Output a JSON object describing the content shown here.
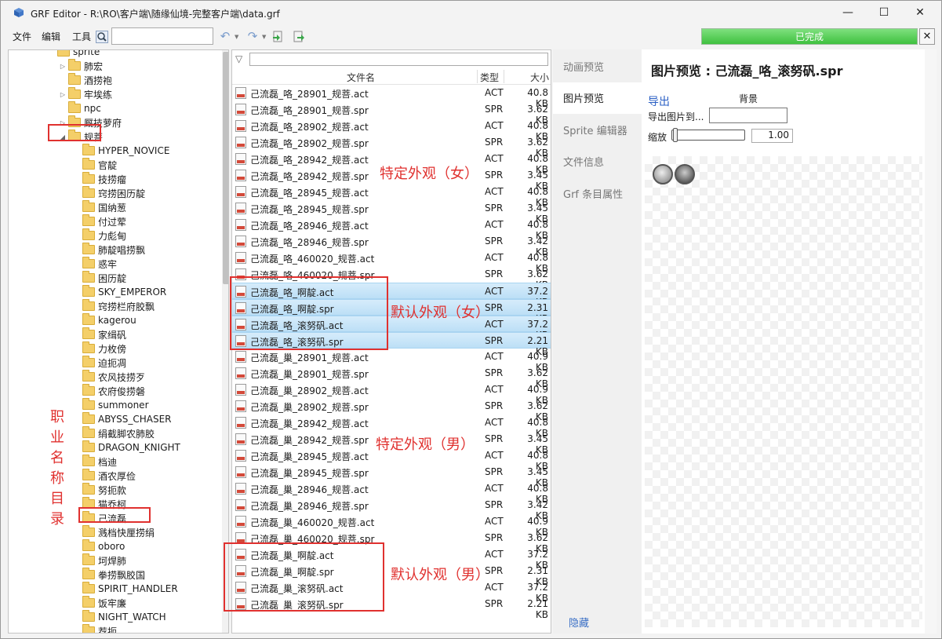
{
  "window": {
    "title": "GRF Editor - R:\\RO\\客户端\\随缘仙境-完整客户端\\data.grf",
    "min_glyph": "—",
    "max_glyph": "☐",
    "close_glyph": "✕"
  },
  "toolbar": {
    "menu_file": "文件",
    "menu_edit": "编辑",
    "menu_tools": "工具",
    "search_value": "",
    "progress_text": "已完成",
    "progress_value": 1.0,
    "progress_close": "✕",
    "icons": [
      "search-icon",
      "undo-icon",
      "redo-icon",
      "extract-icon",
      "export-icon"
    ]
  },
  "tree": {
    "nodes": [
      {
        "label": "sprite",
        "level": 1,
        "arrow": ""
      },
      {
        "label": "肺宏",
        "level": 2,
        "arrow": "▷"
      },
      {
        "label": "酒捞袍",
        "level": 2,
        "arrow": ""
      },
      {
        "label": "牢埃练",
        "level": 2,
        "arrow": "▷"
      },
      {
        "label": "npc",
        "level": 2,
        "arrow": ""
      },
      {
        "label": "厩技萝府",
        "level": 2,
        "arrow": "▷"
      },
      {
        "label": "规菩",
        "level": 2,
        "arrow": "◢"
      },
      {
        "label": "HYPER_NOVICE",
        "level": 3,
        "arrow": ""
      },
      {
        "label": "官靛",
        "level": 3,
        "arrow": ""
      },
      {
        "label": "技捞瘤",
        "level": 3,
        "arrow": ""
      },
      {
        "label": "窍捞困历靛",
        "level": 3,
        "arrow": ""
      },
      {
        "label": "国纳葱",
        "level": 3,
        "arrow": ""
      },
      {
        "label": "付过荤",
        "level": 3,
        "arrow": ""
      },
      {
        "label": "力彪甸",
        "level": 3,
        "arrow": ""
      },
      {
        "label": "肺靛唱捞飘",
        "level": 3,
        "arrow": ""
      },
      {
        "label": "惑牢",
        "level": 3,
        "arrow": ""
      },
      {
        "label": "困历靛",
        "level": 3,
        "arrow": ""
      },
      {
        "label": "SKY_EMPEROR",
        "level": 3,
        "arrow": ""
      },
      {
        "label": "窍捞栏府胶飘",
        "level": 3,
        "arrow": ""
      },
      {
        "label": "kagerou",
        "level": 3,
        "arrow": ""
      },
      {
        "label": "家缉矾",
        "level": 3,
        "arrow": ""
      },
      {
        "label": "力枚傍",
        "level": 3,
        "arrow": ""
      },
      {
        "label": "迫扼凋",
        "level": 3,
        "arrow": ""
      },
      {
        "label": "农风技捞歹",
        "level": 3,
        "arrow": ""
      },
      {
        "label": "农府俊捞磐",
        "level": 3,
        "arrow": ""
      },
      {
        "label": "summoner",
        "level": 3,
        "arrow": ""
      },
      {
        "label": "ABYSS_CHASER",
        "level": 3,
        "arrow": ""
      },
      {
        "label": "绢截脚农肺胶",
        "level": 3,
        "arrow": ""
      },
      {
        "label": "DRAGON_KNIGHT",
        "level": 3,
        "arrow": ""
      },
      {
        "label": "档迪",
        "level": 3,
        "arrow": ""
      },
      {
        "label": "酒农厚俭",
        "level": 3,
        "arrow": ""
      },
      {
        "label": "努扼款",
        "level": 3,
        "arrow": ""
      },
      {
        "label": "猫乔柯",
        "level": 3,
        "arrow": ""
      },
      {
        "label": "己流磊",
        "level": 3,
        "arrow": ""
      },
      {
        "label": "溅档快厘捞绢",
        "level": 3,
        "arrow": ""
      },
      {
        "label": "oboro",
        "level": 3,
        "arrow": ""
      },
      {
        "label": "坷焊肺",
        "level": 3,
        "arrow": ""
      },
      {
        "label": "拳捞飘胶国",
        "level": 3,
        "arrow": ""
      },
      {
        "label": "SPIRIT_HANDLER",
        "level": 3,
        "arrow": ""
      },
      {
        "label": "饭牢廉",
        "level": 3,
        "arrow": ""
      },
      {
        "label": "NIGHT_WATCH",
        "level": 3,
        "arrow": ""
      },
      {
        "label": "荐扼",
        "level": 3,
        "arrow": ""
      }
    ],
    "annot_vertical": [
      "职",
      "业",
      "名",
      "称",
      "目",
      "录"
    ]
  },
  "filelist": {
    "filter_value": "",
    "headers": {
      "name": "文件名",
      "type": "类型",
      "size": "大小"
    },
    "rows": [
      {
        "name": "己流磊_咯_28901_规菩.act",
        "type": "ACT",
        "size": "40.8 KB",
        "sel": false
      },
      {
        "name": "己流磊_咯_28901_规菩.spr",
        "type": "SPR",
        "size": "3.62 KB",
        "sel": false
      },
      {
        "name": "己流磊_咯_28902_规菩.act",
        "type": "ACT",
        "size": "40.8 KB",
        "sel": false
      },
      {
        "name": "己流磊_咯_28902_规菩.spr",
        "type": "SPR",
        "size": "3.62 KB",
        "sel": false
      },
      {
        "name": "己流磊_咯_28942_规菩.act",
        "type": "ACT",
        "size": "40.8 KB",
        "sel": false
      },
      {
        "name": "己流磊_咯_28942_规菩.spr",
        "type": "SPR",
        "size": "3.45 KB",
        "sel": false
      },
      {
        "name": "己流磊_咯_28945_规菩.act",
        "type": "ACT",
        "size": "40.8 KB",
        "sel": false
      },
      {
        "name": "己流磊_咯_28945_规菩.spr",
        "type": "SPR",
        "size": "3.45 KB",
        "sel": false
      },
      {
        "name": "己流磊_咯_28946_规菩.act",
        "type": "ACT",
        "size": "40.8 KB",
        "sel": false
      },
      {
        "name": "己流磊_咯_28946_规菩.spr",
        "type": "SPR",
        "size": "3.42 KB",
        "sel": false
      },
      {
        "name": "己流磊_咯_460020_规菩.act",
        "type": "ACT",
        "size": "40.8 KB",
        "sel": false
      },
      {
        "name": "己流磊_咯_460020_规菩.spr",
        "type": "SPR",
        "size": "3.62 KB",
        "sel": false
      },
      {
        "name": "己流磊_咯_啊靛.act",
        "type": "ACT",
        "size": "37.2 KB",
        "sel": true
      },
      {
        "name": "己流磊_咯_啊靛.spr",
        "type": "SPR",
        "size": "2.31 KB",
        "sel": true
      },
      {
        "name": "己流磊_咯_滚努矾.act",
        "type": "ACT",
        "size": "37.2 KB",
        "sel": true
      },
      {
        "name": "己流磊_咯_滚努矾.spr",
        "type": "SPR",
        "size": "2.21 KB",
        "sel": true
      },
      {
        "name": "己流磊_巢_28901_规菩.act",
        "type": "ACT",
        "size": "40.9 KB",
        "sel": false
      },
      {
        "name": "己流磊_巢_28901_规菩.spr",
        "type": "SPR",
        "size": "3.62 KB",
        "sel": false
      },
      {
        "name": "己流磊_巢_28902_规菩.act",
        "type": "ACT",
        "size": "40.9 KB",
        "sel": false
      },
      {
        "name": "己流磊_巢_28902_规菩.spr",
        "type": "SPR",
        "size": "3.62 KB",
        "sel": false
      },
      {
        "name": "己流磊_巢_28942_规菩.act",
        "type": "ACT",
        "size": "40.8 KB",
        "sel": false
      },
      {
        "name": "己流磊_巢_28942_规菩.spr",
        "type": "SPR",
        "size": "3.45 KB",
        "sel": false
      },
      {
        "name": "己流磊_巢_28945_规菩.act",
        "type": "ACT",
        "size": "40.8 KB",
        "sel": false
      },
      {
        "name": "己流磊_巢_28945_规菩.spr",
        "type": "SPR",
        "size": "3.45 KB",
        "sel": false
      },
      {
        "name": "己流磊_巢_28946_规菩.act",
        "type": "ACT",
        "size": "40.8 KB",
        "sel": false
      },
      {
        "name": "己流磊_巢_28946_规菩.spr",
        "type": "SPR",
        "size": "3.42 KB",
        "sel": false
      },
      {
        "name": "己流磊_巢_460020_规菩.act",
        "type": "ACT",
        "size": "40.9 KB",
        "sel": false
      },
      {
        "name": "己流磊_巢_460020_规菩.spr",
        "type": "SPR",
        "size": "3.62 KB",
        "sel": false
      },
      {
        "name": "己流磊_巢_啊靛.act",
        "type": "ACT",
        "size": "37.2 KB",
        "sel": false
      },
      {
        "name": "己流磊_巢_啊靛.spr",
        "type": "SPR",
        "size": "2.31 KB",
        "sel": false
      },
      {
        "name": "己流磊_巢_滚努矾.act",
        "type": "ACT",
        "size": "37.2 KB",
        "sel": false
      },
      {
        "name": "己流磊_巢_滚努矾.spr",
        "type": "SPR",
        "size": "2.21 KB",
        "sel": false
      }
    ],
    "annot_female_special": "特定外观（女）",
    "annot_female_default": "默认外观（女）",
    "annot_male_special": "特定外观（男）",
    "annot_male_default": "默认外观（男）"
  },
  "tabs": {
    "items": [
      "动画预览",
      "图片预览",
      "Sprite 编辑器",
      "文件信息",
      "Grf 条目属性"
    ],
    "active": 1,
    "hide": "隐藏"
  },
  "preview": {
    "title": "图片预览 : 己流磊_咯_滚努矾.spr",
    "export": "导出",
    "background": "背景",
    "export_to": "导出图片到...",
    "zoom_label": "缩放",
    "zoom_value": "1.00"
  },
  "colors": {
    "annotation": "#e0312f",
    "progress": "#3fc13f",
    "selection": "#bcdff6"
  }
}
